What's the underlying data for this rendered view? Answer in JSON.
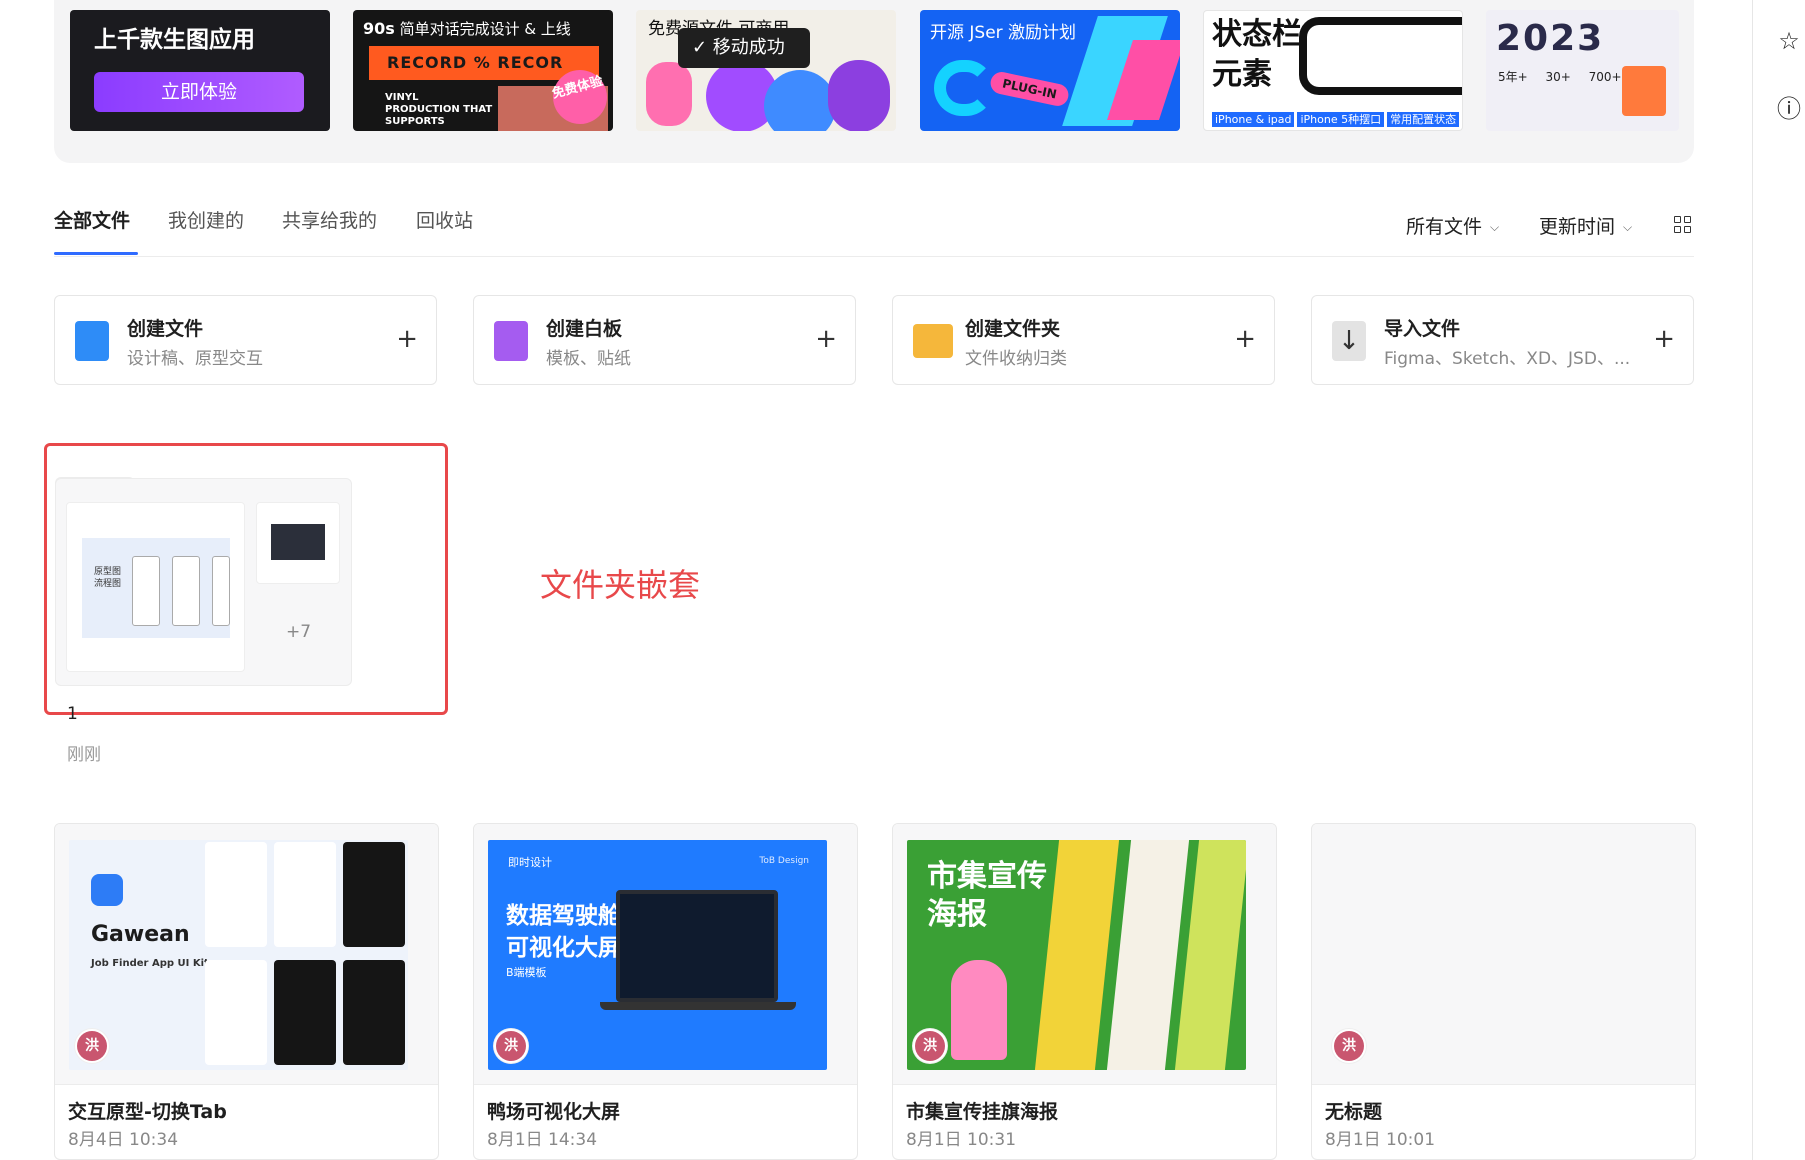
{
  "banners": {
    "b1": {
      "title": "上千款生图应用",
      "button": "立即体验"
    },
    "b2": {
      "title_bold": "90s",
      "title": " 简单对话完成设计 & 上线",
      "record": "RECORD % RECOR",
      "vinyl": "VINYL PRODUCTION THAT SUPPORTS",
      "badge": "免费体验"
    },
    "b3": {
      "title": "免费源文件  可商用"
    },
    "b4": {
      "title": "开源 JSer 激励计划",
      "plug": "PLUG-IN"
    },
    "b5": {
      "title_line1": "状态栏",
      "title_line2": "元素",
      "tag1": "iPhone & ipad",
      "tag2": "iPhone 5种摆口",
      "tag3": "常用配置状态"
    },
    "b6": {
      "year": "2023",
      "stats": "5年+ 30+ 700+"
    }
  },
  "toast": {
    "text": "✓ 移动成功"
  },
  "right_panel": {
    "star_icon": "star-icon",
    "info_icon": "info-icon"
  },
  "tabs": [
    {
      "label": "全部文件",
      "active": true
    },
    {
      "label": "我创建的",
      "active": false
    },
    {
      "label": "共享给我的",
      "active": false
    },
    {
      "label": "回收站",
      "active": false
    }
  ],
  "filters": {
    "type": "所有文件",
    "sort": "更新时间",
    "view_icon": "grid-view-icon"
  },
  "create_cards": [
    {
      "title": "创建文件",
      "subtitle": "设计稿、原型交互",
      "icon": "design-file-icon",
      "color": "#2e8cf7"
    },
    {
      "title": "创建白板",
      "subtitle": "模板、贴纸",
      "icon": "whiteboard-icon",
      "color": "#a55cf0"
    },
    {
      "title": "创建文件夹",
      "subtitle": "文件收纳归类",
      "icon": "folder-icon",
      "color": "#f5b73b"
    },
    {
      "title": "导入文件",
      "subtitle": "Figma、Sketch、XD、JSD、...",
      "icon": "import-icon",
      "color": "#e3e3e3"
    }
  ],
  "folder": {
    "name": "1",
    "time": "刚刚",
    "more_count": "+7",
    "thumb_text": "原型图 流程图"
  },
  "annotation": {
    "text": "文件夹嵌套",
    "color": "#e8484a"
  },
  "files": [
    {
      "name": "交互原型-切换Tab",
      "time": "8月4日 10:34",
      "avatar": "洪",
      "thumb_brand": "Gawean",
      "thumb_kit": "Job Finder App UI Kit"
    },
    {
      "name": "鸭场可视化大屏",
      "time": "8月1日 14:34",
      "avatar": "洪",
      "thumb_tag": "即时设计",
      "thumb_tag2": "ToB Design",
      "thumb_title": "数据驾驶舱 可视化大屏",
      "thumb_sub": "B端模板"
    },
    {
      "name": "市集宣传挂旗海报",
      "time": "8月1日 10:31",
      "avatar": "洪",
      "thumb_title": "市集宣传 海报"
    },
    {
      "name": "无标题",
      "time": "8月1日 10:01",
      "avatar": "洪"
    }
  ]
}
